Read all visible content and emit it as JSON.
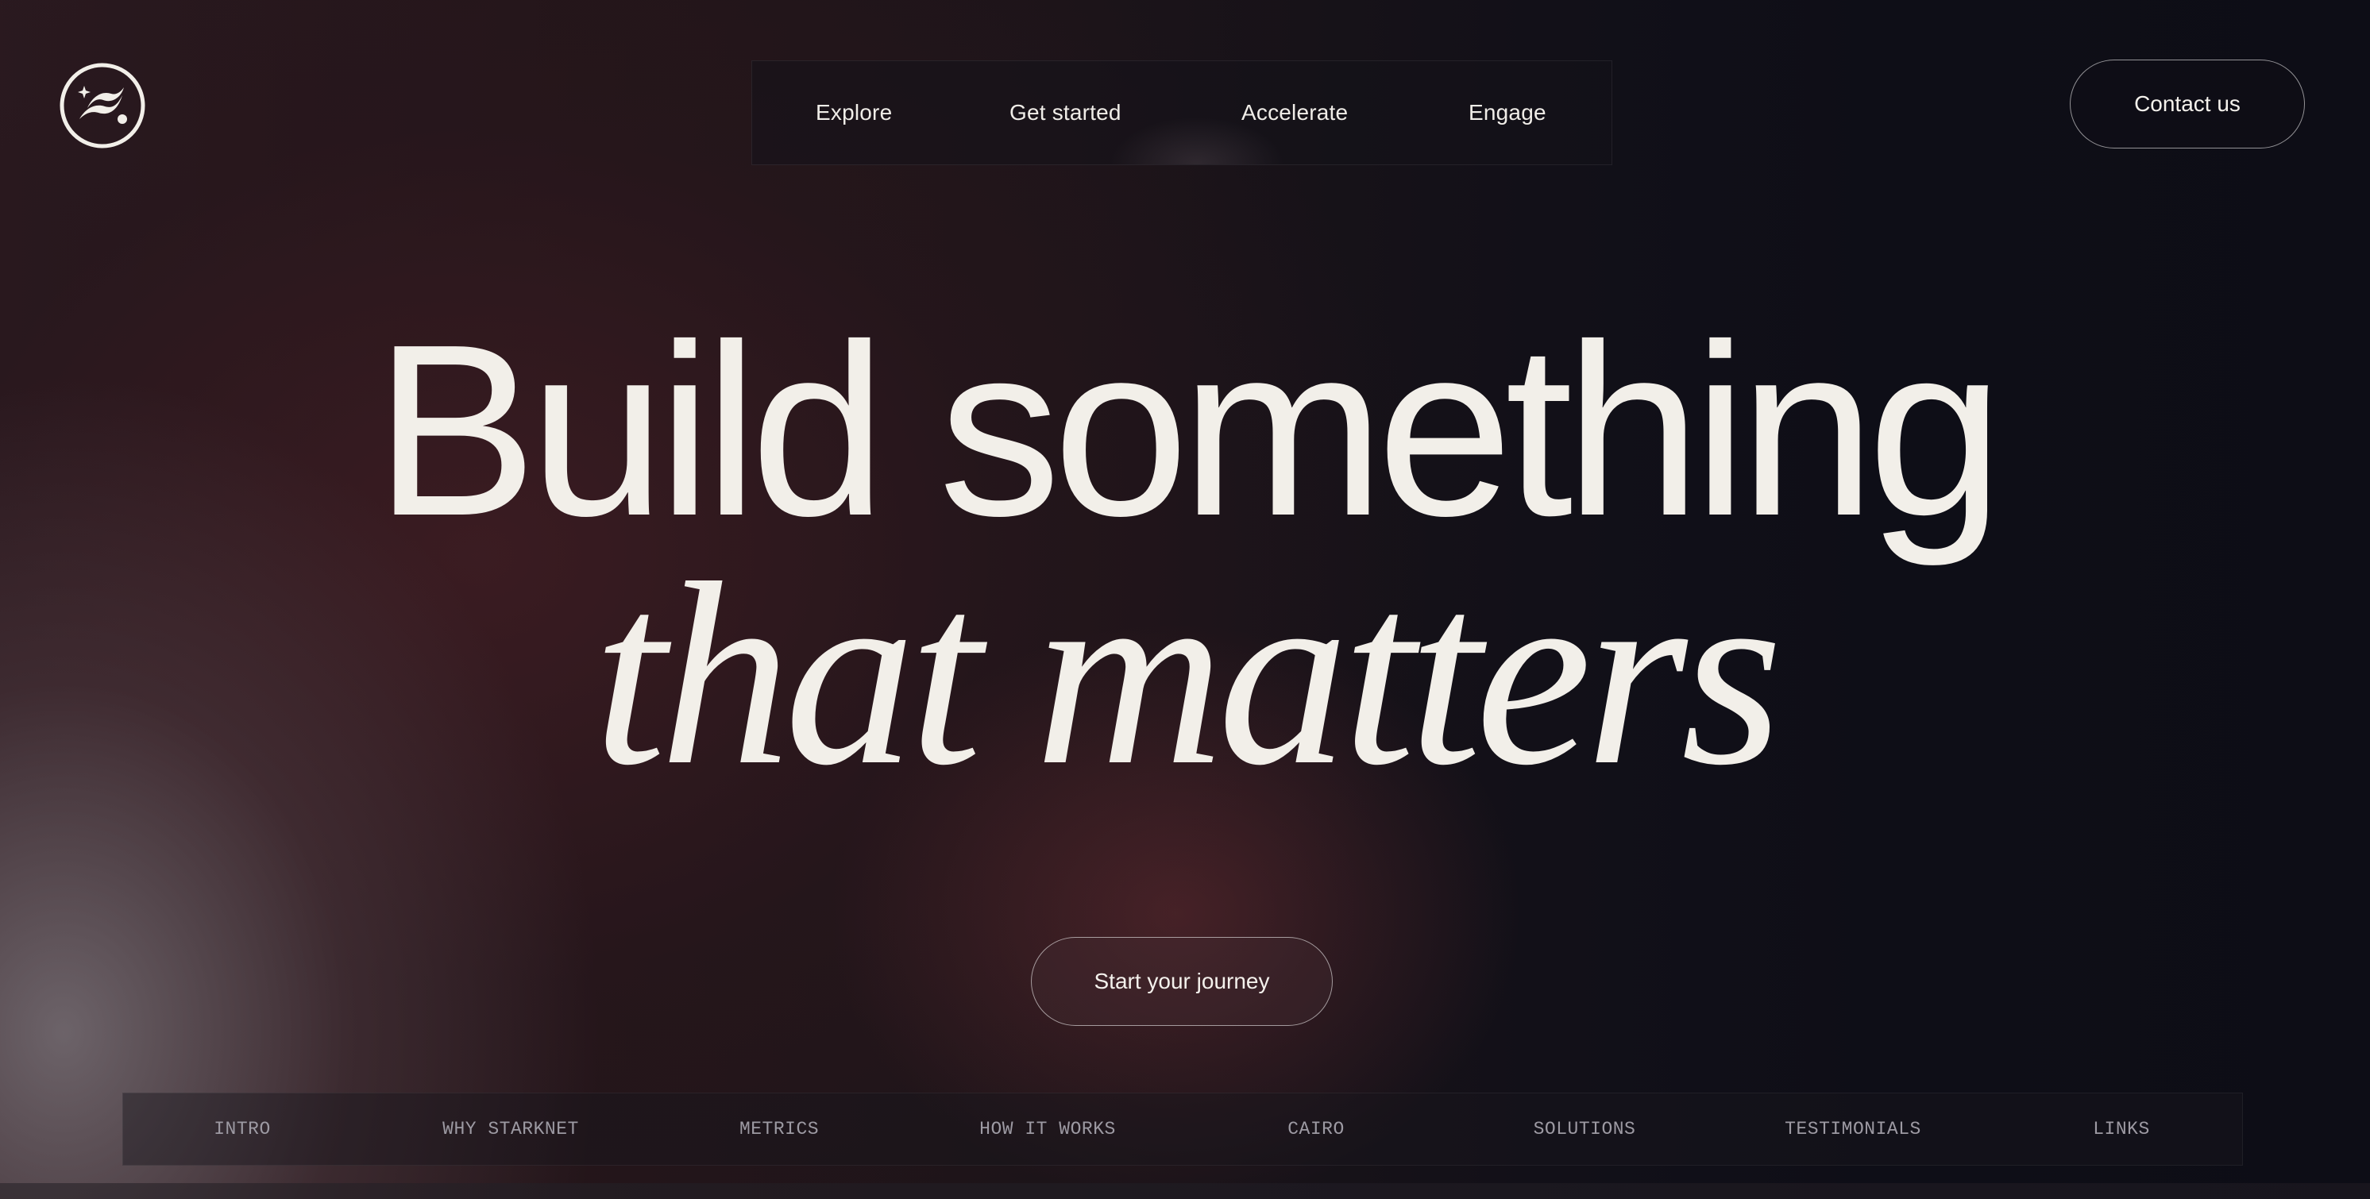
{
  "logo": {
    "icon": "starknet-logo-icon"
  },
  "nav": {
    "items": [
      {
        "label": "Explore"
      },
      {
        "label": "Get started"
      },
      {
        "label": "Accelerate"
      },
      {
        "label": "Engage"
      }
    ]
  },
  "contact": {
    "label": "Contact us"
  },
  "hero": {
    "line1": "Build something",
    "line2": "that matters"
  },
  "cta": {
    "label": "Start your journey"
  },
  "sections": {
    "items": [
      {
        "label": "INTRO"
      },
      {
        "label": "WHY STARKNET"
      },
      {
        "label": "METRICS"
      },
      {
        "label": "HOW IT WORKS"
      },
      {
        "label": "CAIRO"
      },
      {
        "label": "SOLUTIONS"
      },
      {
        "label": "TESTIMONIALS"
      },
      {
        "label": "LINKS"
      }
    ]
  },
  "colors": {
    "text": "#f2efe9",
    "muted_text": "#9d9aa3",
    "background_dark": "#0d0d16",
    "background_warm": "#2a1a20"
  }
}
